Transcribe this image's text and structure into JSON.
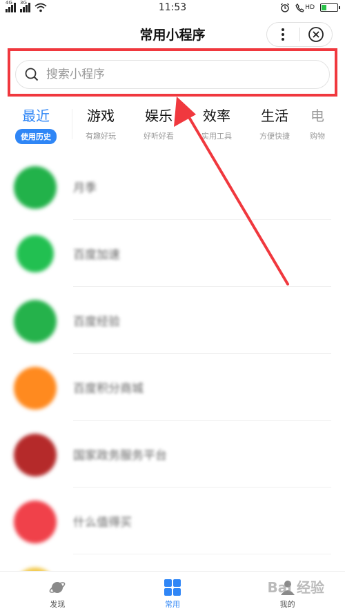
{
  "status_bar": {
    "signal1_tag": "4G",
    "signal2_tag": "3G",
    "time": "11:53",
    "hd_tag": "HD"
  },
  "header": {
    "title": "常用小程序"
  },
  "search": {
    "placeholder": "搜索小程序"
  },
  "tabs": [
    {
      "name": "最近",
      "sub": "使用历史",
      "active": true
    },
    {
      "name": "游戏",
      "sub": "有趣好玩"
    },
    {
      "name": "娱乐",
      "sub": "好听好看"
    },
    {
      "name": "效率",
      "sub": "实用工具"
    },
    {
      "name": "生活",
      "sub": "方便快捷"
    },
    {
      "name": "电",
      "sub": "购物"
    }
  ],
  "apps": [
    {
      "name": "月季",
      "color": "#22b24a"
    },
    {
      "name": "百度加速",
      "color": "#22c051"
    },
    {
      "name": "百度经验",
      "color": "#25b24b"
    },
    {
      "name": "百度积分商城",
      "color": "#ff8a1f"
    },
    {
      "name": "国家政务服务平台",
      "color": "#b52a2a"
    },
    {
      "name": "什么值得买",
      "color": "#f0414a"
    }
  ],
  "bottom_nav": [
    {
      "label": "发现",
      "icon": "planet-icon"
    },
    {
      "label": "常用",
      "icon": "grid-icon",
      "active": true
    },
    {
      "label": "我的",
      "icon": "user-icon"
    }
  ],
  "watermark": "Bai 经验",
  "colors": {
    "accent": "#2f86f6",
    "highlight": "#f0383e"
  }
}
